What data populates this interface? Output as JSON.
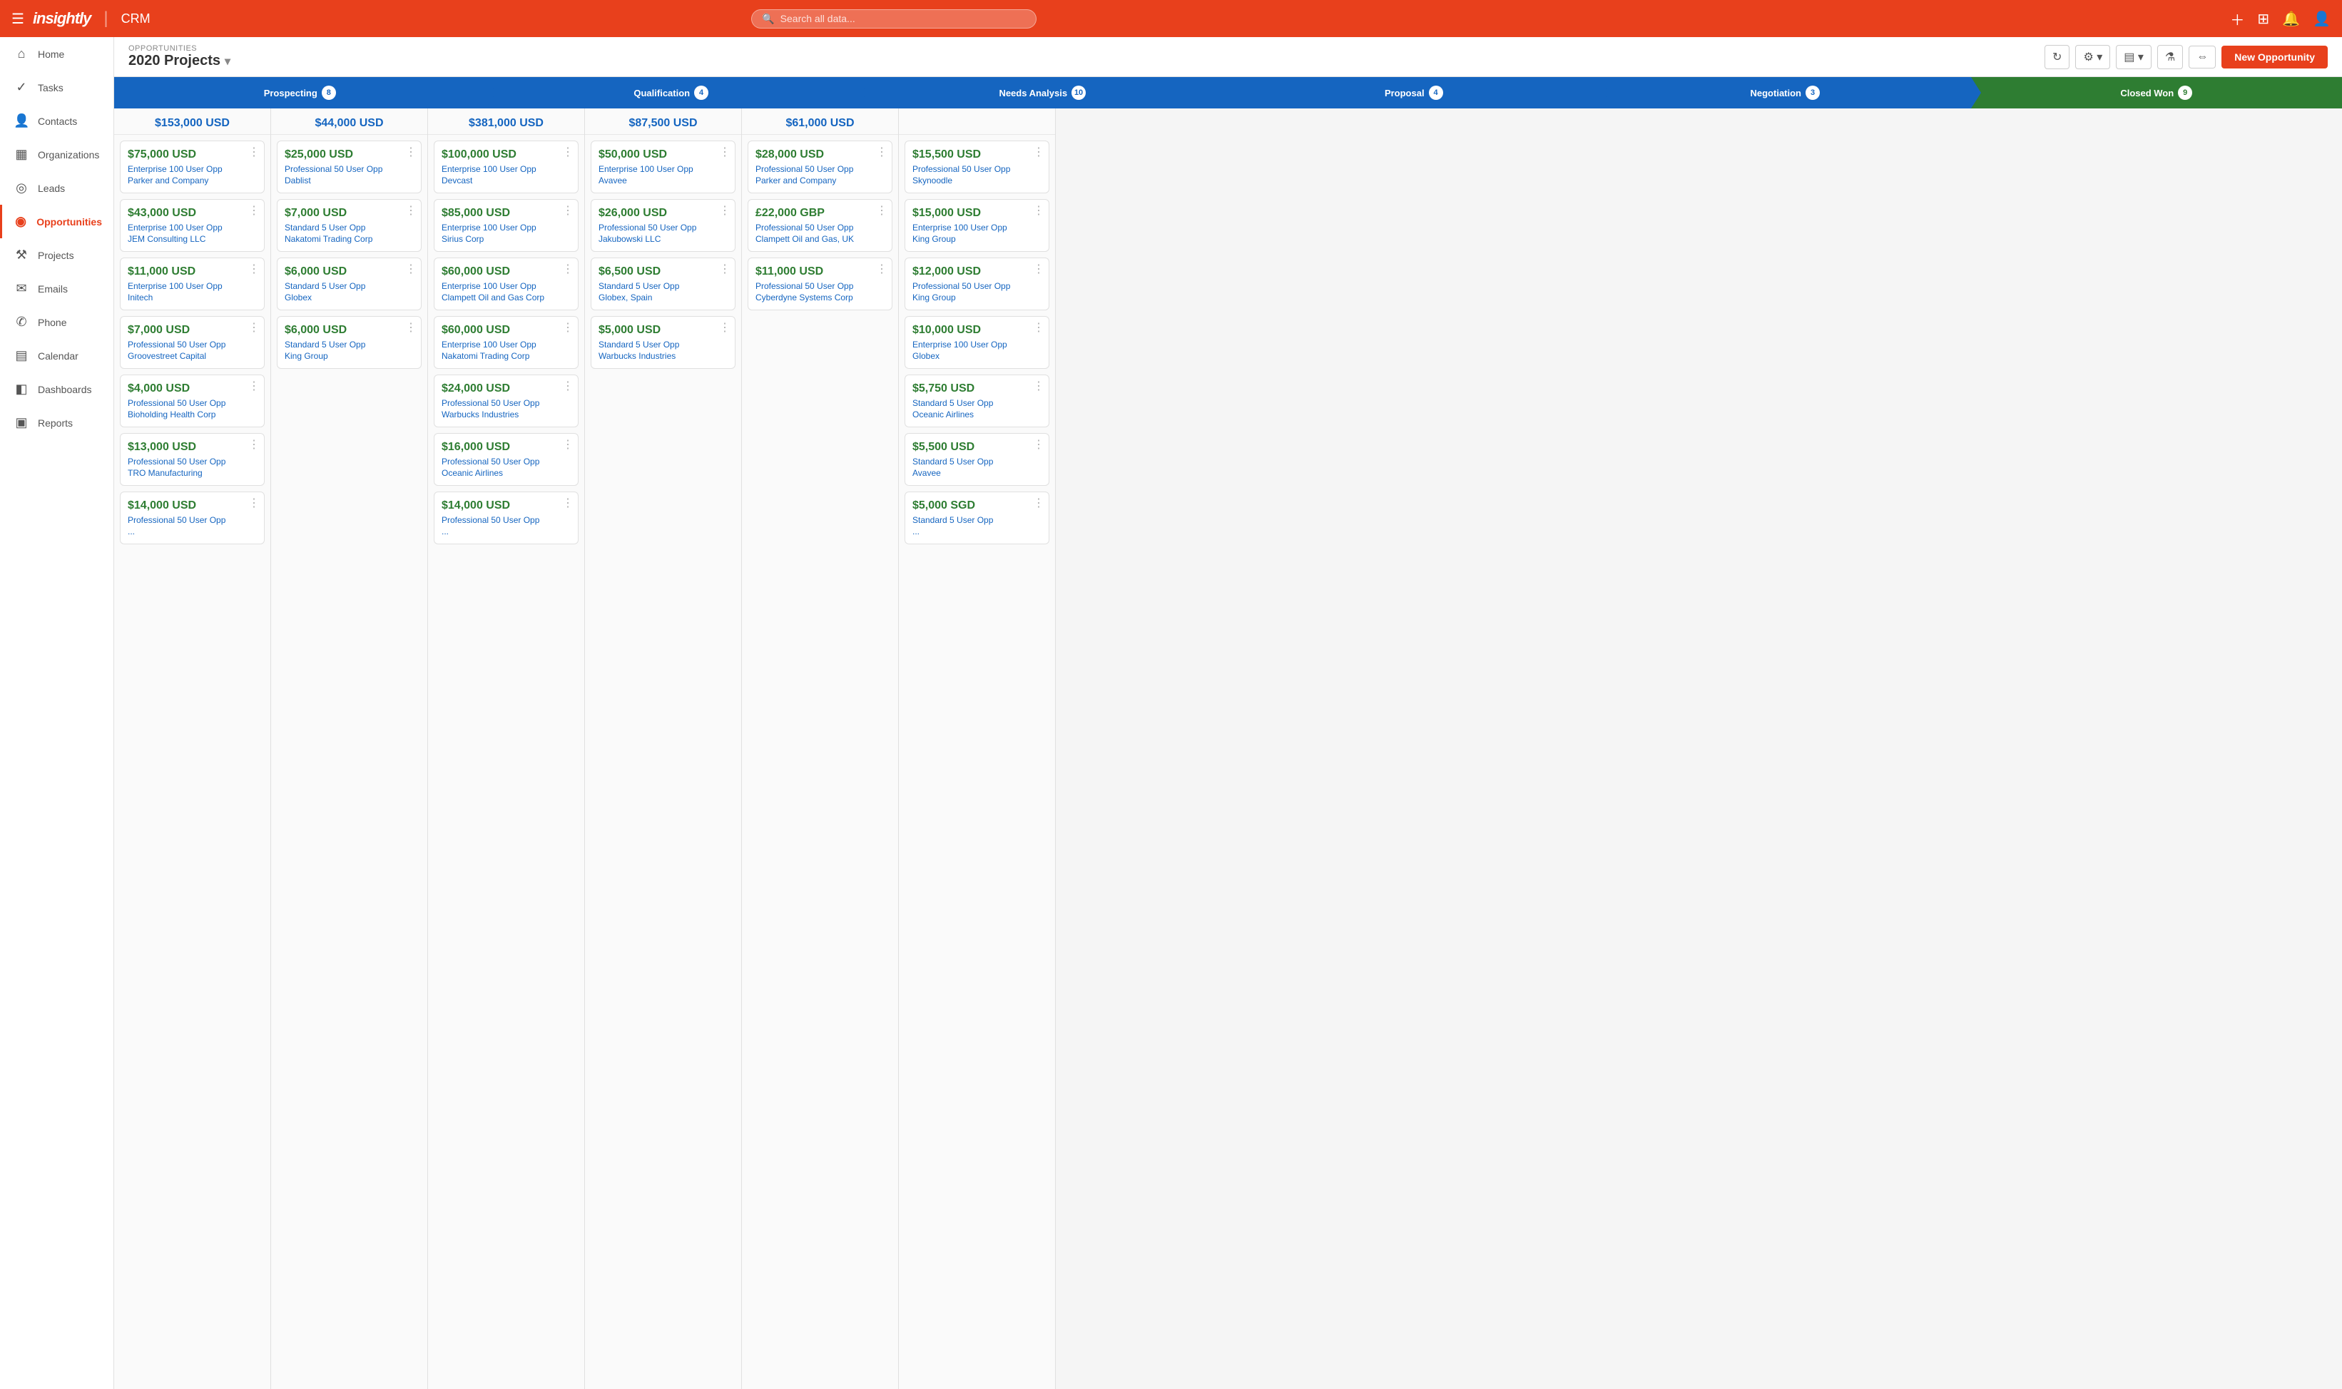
{
  "app": {
    "logo": "insightly",
    "product": "CRM",
    "search_placeholder": "Search all data..."
  },
  "sidebar": {
    "items": [
      {
        "id": "home",
        "label": "Home",
        "icon": "⌂"
      },
      {
        "id": "tasks",
        "label": "Tasks",
        "icon": "✓"
      },
      {
        "id": "contacts",
        "label": "Contacts",
        "icon": "👤"
      },
      {
        "id": "organizations",
        "label": "Organizations",
        "icon": "▦"
      },
      {
        "id": "leads",
        "label": "Leads",
        "icon": "◎"
      },
      {
        "id": "opportunities",
        "label": "Opportunities",
        "icon": "◉",
        "active": true
      },
      {
        "id": "projects",
        "label": "Projects",
        "icon": "⚒"
      },
      {
        "id": "emails",
        "label": "Emails",
        "icon": "✉"
      },
      {
        "id": "phone",
        "label": "Phone",
        "icon": "✆"
      },
      {
        "id": "calendar",
        "label": "Calendar",
        "icon": "▤"
      },
      {
        "id": "dashboards",
        "label": "Dashboards",
        "icon": "◧"
      },
      {
        "id": "reports",
        "label": "Reports",
        "icon": "▣"
      }
    ]
  },
  "header": {
    "breadcrumb": "OPPORTUNITIES",
    "title": "2020 Projects",
    "new_button": "New Opportunity"
  },
  "stages": [
    {
      "id": "prospecting",
      "label": "Prospecting",
      "count": "8",
      "style": "normal"
    },
    {
      "id": "qualification",
      "label": "Qualification",
      "count": "4",
      "style": "normal"
    },
    {
      "id": "needs-analysis",
      "label": "Needs Analysis",
      "count": "10",
      "style": "normal"
    },
    {
      "id": "proposal",
      "label": "Proposal",
      "count": "4",
      "style": "normal"
    },
    {
      "id": "negotiation",
      "label": "Negotiation",
      "count": "3",
      "style": "normal"
    },
    {
      "id": "closed-won",
      "label": "Closed Won",
      "count": "9",
      "style": "closed-won"
    }
  ],
  "columns": [
    {
      "id": "prospecting",
      "total": "$153,000 USD",
      "cards": [
        {
          "amount": "$75,000 USD",
          "type": "Enterprise 100 User Opp",
          "company": "Parker and Company"
        },
        {
          "amount": "$43,000 USD",
          "type": "Enterprise 100 User Opp",
          "company": "JEM Consulting LLC"
        },
        {
          "amount": "$11,000 USD",
          "type": "Enterprise 100 User Opp",
          "company": "Initech"
        },
        {
          "amount": "$7,000 USD",
          "type": "Professional 50 User Opp",
          "company": "Groovestreet Capital"
        },
        {
          "amount": "$4,000 USD",
          "type": "Professional 50 User Opp",
          "company": "Bioholding Health Corp"
        },
        {
          "amount": "$13,000 USD",
          "type": "Professional 50 User Opp",
          "company": "TRO Manufacturing"
        },
        {
          "amount": "$14,000 USD",
          "type": "Professional 50 User Opp",
          "company": "..."
        }
      ]
    },
    {
      "id": "qualification",
      "total": "$44,000 USD",
      "cards": [
        {
          "amount": "$25,000 USD",
          "type": "Professional 50 User Opp",
          "company": "Dablist"
        },
        {
          "amount": "$7,000 USD",
          "type": "Standard 5 User Opp",
          "company": "Nakatomi Trading Corp"
        },
        {
          "amount": "$6,000 USD",
          "type": "Standard 5 User Opp",
          "company": "Globex"
        },
        {
          "amount": "$6,000 USD",
          "type": "Standard 5 User Opp",
          "company": "King Group"
        }
      ]
    },
    {
      "id": "needs-analysis",
      "total": "$381,000 USD",
      "cards": [
        {
          "amount": "$100,000 USD",
          "type": "Enterprise 100 User Opp",
          "company": "Devcast"
        },
        {
          "amount": "$85,000 USD",
          "type": "Enterprise 100 User Opp",
          "company": "Sirius Corp"
        },
        {
          "amount": "$60,000 USD",
          "type": "Enterprise 100 User Opp",
          "company": "Clampett Oil and Gas Corp"
        },
        {
          "amount": "$60,000 USD",
          "type": "Enterprise 100 User Opp",
          "company": "Nakatomi Trading Corp"
        },
        {
          "amount": "$24,000 USD",
          "type": "Professional 50 User Opp",
          "company": "Warbucks Industries"
        },
        {
          "amount": "$16,000 USD",
          "type": "Professional 50 User Opp",
          "company": "Oceanic Airlines"
        },
        {
          "amount": "$14,000 USD",
          "type": "Professional 50 User Opp",
          "company": "..."
        }
      ]
    },
    {
      "id": "proposal",
      "total": "$87,500 USD",
      "cards": [
        {
          "amount": "$50,000 USD",
          "type": "Enterprise 100 User Opp",
          "company": "Avavee"
        },
        {
          "amount": "$26,000 USD",
          "type": "Professional 50 User Opp",
          "company": "Jakubowski LLC"
        },
        {
          "amount": "$6,500 USD",
          "type": "Standard 5 User Opp",
          "company": "Globex, Spain"
        },
        {
          "amount": "$5,000 USD",
          "type": "Standard 5 User Opp",
          "company": "Warbucks Industries"
        }
      ]
    },
    {
      "id": "negotiation",
      "total": "$61,000 USD",
      "cards": [
        {
          "amount": "$28,000 USD",
          "type": "Professional 50 User Opp",
          "company": "Parker and Company"
        },
        {
          "amount": "£22,000 GBP",
          "type": "Professional 50 User Opp",
          "company": "Clampett Oil and Gas, UK"
        },
        {
          "amount": "$11,000 USD",
          "type": "Professional 50 User Opp",
          "company": "Cyberdyne Systems Corp"
        }
      ]
    },
    {
      "id": "closed-won",
      "total": "",
      "cards": [
        {
          "amount": "$15,500 USD",
          "type": "Professional 50 User Opp",
          "company": "Skynoodle"
        },
        {
          "amount": "$15,000 USD",
          "type": "Enterprise 100 User Opp",
          "company": "King Group"
        },
        {
          "amount": "$12,000 USD",
          "type": "Professional 50 User Opp",
          "company": "King Group"
        },
        {
          "amount": "$10,000 USD",
          "type": "Enterprise 100 User Opp",
          "company": "Globex"
        },
        {
          "amount": "$5,750 USD",
          "type": "Standard 5 User Opp",
          "company": "Oceanic Airlines"
        },
        {
          "amount": "$5,500 USD",
          "type": "Standard 5 User Opp",
          "company": "Avavee"
        },
        {
          "amount": "$5,000 SGD",
          "type": "Standard 5 User Opp",
          "company": "..."
        }
      ]
    }
  ]
}
